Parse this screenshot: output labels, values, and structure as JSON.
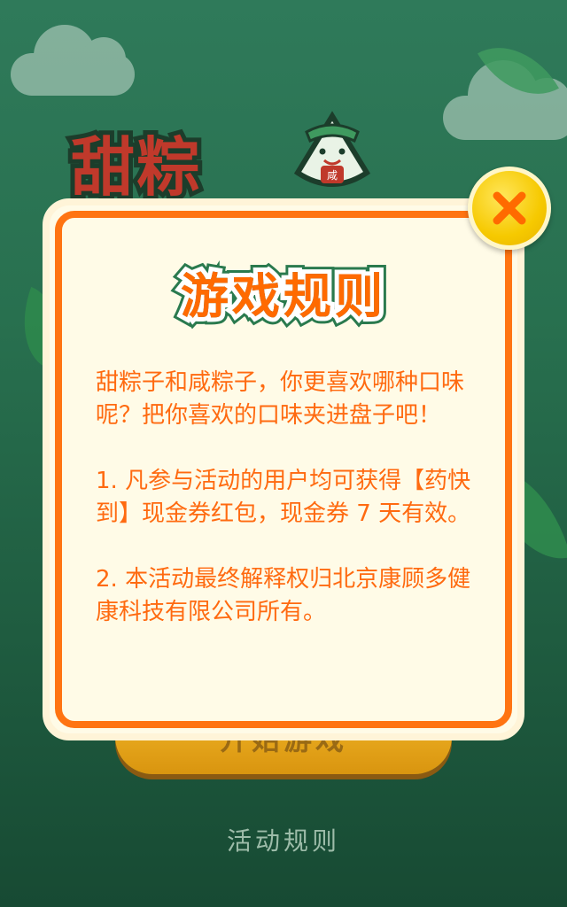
{
  "background": {
    "title_art_text": "甜粽",
    "mascot_badge": "咸",
    "start_button_label": "开始游戏",
    "rules_link_label": "活动规则"
  },
  "modal": {
    "title": "游戏规则",
    "paragraphs": [
      "甜粽子和咸粽子，你更喜欢哪种口味呢？把你喜欢的口味夹进盘子吧！",
      "1. 凡参与活动的用户均可获得【药快到】现金券红包，现金券 7 天有效。",
      "2. 本活动最终解释权归北京康顾多健康科技有限公司所有。"
    ],
    "close_icon": "close-x-icon"
  },
  "colors": {
    "accent_orange": "#ff7412",
    "modal_bg": "#fffbe7",
    "close_yellow": "#f6c900",
    "background_green": "#28704f"
  }
}
